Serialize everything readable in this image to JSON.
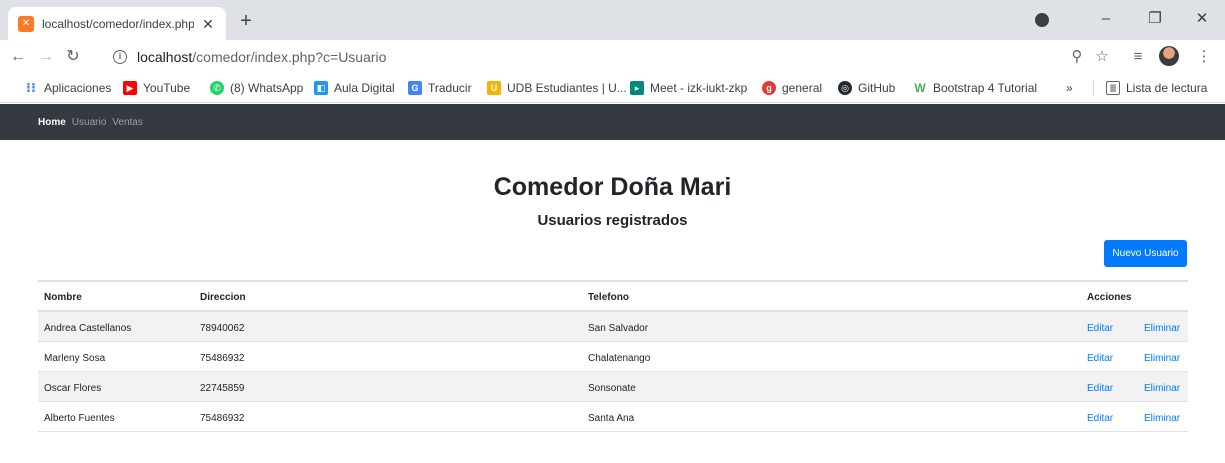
{
  "browser": {
    "tab_title": "localhost/comedor/index.php?c=",
    "tab_favicon": "xampp-icon",
    "url_host": "localhost",
    "url_path": "/comedor/index.php?c=Usuario",
    "bookmarks": [
      {
        "label": "Aplicaciones",
        "icon": "apps-grid-icon",
        "color": "#4285f4"
      },
      {
        "label": "YouTube",
        "icon": "youtube-icon",
        "color": "#ff0000"
      },
      {
        "label": "(8) WhatsApp",
        "icon": "whatsapp-icon",
        "color": "#25d366"
      },
      {
        "label": "Aula Digital",
        "icon": "aula-digital-icon",
        "color": "#2196f3"
      },
      {
        "label": "Traducir",
        "icon": "translate-icon",
        "color": "#4285f4"
      },
      {
        "label": "UDB Estudiantes | U...",
        "icon": "udb-icon",
        "color": "#f4b400"
      },
      {
        "label": "Meet - izk-iukt-zkp",
        "icon": "meet-icon",
        "color": "#00897b"
      },
      {
        "label": "general",
        "icon": "general-icon",
        "color": "#e53935"
      },
      {
        "label": "GitHub",
        "icon": "github-icon",
        "color": "#24292e"
      },
      {
        "label": "Bootstrap 4 Tutorial",
        "icon": "w3schools-icon",
        "color": "#4caf50"
      }
    ],
    "more_bookmarks": "»",
    "reading_list": "Lista de lectura"
  },
  "nav": {
    "home": "Home",
    "usuario": "Usuario",
    "ventas": "Ventas"
  },
  "page": {
    "title": "Comedor Doña Mari",
    "subtitle": "Usuarios registrados",
    "new_button": "Nuevo Usuario"
  },
  "table": {
    "headers": [
      "Nombre",
      "Direccion",
      "Telefono",
      "Acciones"
    ],
    "rows": [
      {
        "nombre": "Andrea Castellanos",
        "direccion": "78940062",
        "telefono": "San Salvador"
      },
      {
        "nombre": "Marleny Sosa",
        "direccion": "75486932",
        "telefono": "Chalatenango"
      },
      {
        "nombre": "Oscar Flores",
        "direccion": "22745859",
        "telefono": "Sonsonate"
      },
      {
        "nombre": "Alberto Fuentes",
        "direccion": "75486932",
        "telefono": "Santa Ana"
      }
    ],
    "edit_label": "Editar",
    "delete_label": "Eliminar"
  },
  "colors": {
    "navbar": "#343a40",
    "primary": "#007bff",
    "stripe": "#f2f2f2"
  }
}
